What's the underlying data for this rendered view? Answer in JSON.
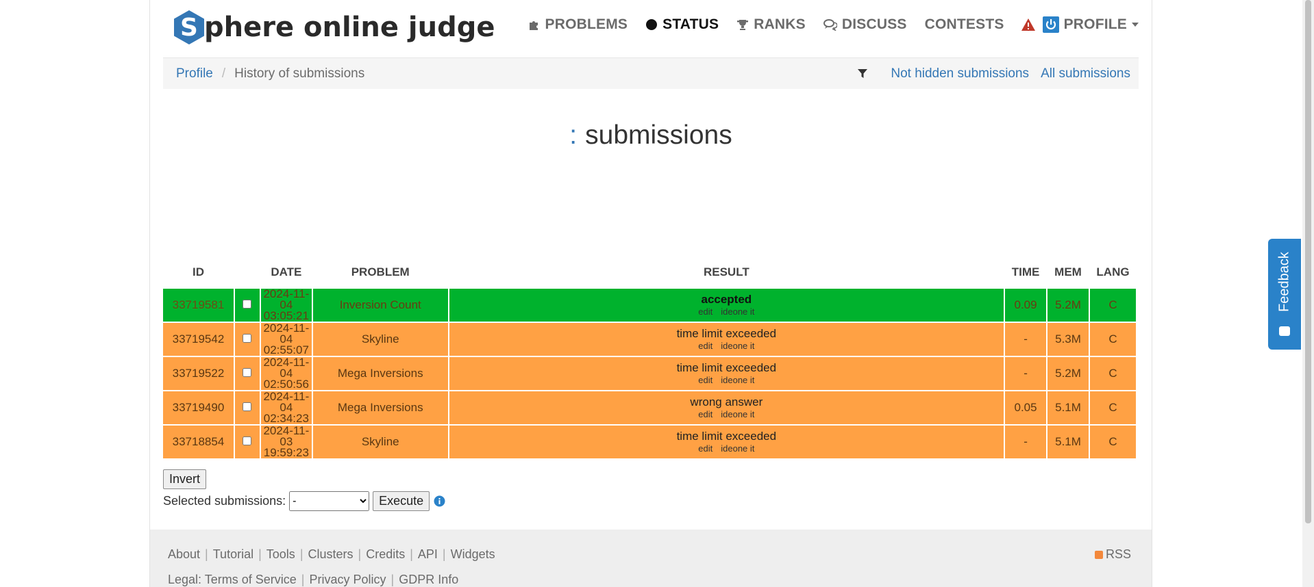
{
  "header": {
    "logo_letter": "S",
    "logo_text": "phere online judge",
    "nav": {
      "problems": "PROBLEMS",
      "status": "STATUS",
      "ranks": "RANKS",
      "discuss": "DISCUSS",
      "contests": "CONTESTS",
      "profile": "PROFILE"
    }
  },
  "breadcrumb": {
    "profile": "Profile",
    "current": "History of submissions"
  },
  "filters": {
    "not_hidden": "Not hidden submissions",
    "all": "All submissions"
  },
  "page": {
    "title_prefix": ":",
    "title": "submissions"
  },
  "table": {
    "headers": {
      "id": "ID",
      "date": "DATE",
      "problem": "PROBLEM",
      "result": "RESULT",
      "time": "TIME",
      "mem": "MEM",
      "lang": "LANG"
    },
    "links": {
      "edit": "edit",
      "ideone": "ideone it"
    },
    "rows": [
      {
        "id": "33719581",
        "date": "2024-11-04",
        "time_of_day": "03:05:21",
        "problem": "Inversion Count",
        "result": "accepted",
        "time": "0.09",
        "mem": "5.2M",
        "lang": "C",
        "status_color": "#00b22d"
      },
      {
        "id": "33719542",
        "date": "2024-11-04",
        "time_of_day": "02:55:07",
        "problem": "Skyline",
        "result": "time limit exceeded",
        "time": "-",
        "mem": "5.3M",
        "lang": "C",
        "status_color": "#ffa144"
      },
      {
        "id": "33719522",
        "date": "2024-11-04",
        "time_of_day": "02:50:56",
        "problem": "Mega Inversions",
        "result": "time limit exceeded",
        "time": "-",
        "mem": "5.2M",
        "lang": "C",
        "status_color": "#ffa144"
      },
      {
        "id": "33719490",
        "date": "2024-11-04",
        "time_of_day": "02:34:23",
        "problem": "Mega Inversions",
        "result": "wrong answer",
        "time": "0.05",
        "mem": "5.1M",
        "lang": "C",
        "status_color": "#ffa144"
      },
      {
        "id": "33718854",
        "date": "2024-11-03",
        "time_of_day": "19:59:23",
        "problem": "Skyline",
        "result": "time limit exceeded",
        "time": "-",
        "mem": "5.1M",
        "lang": "C",
        "status_color": "#ffa144"
      }
    ]
  },
  "controls": {
    "invert_label": "Invert",
    "selected_label": "Selected submissions:",
    "select_value": "-",
    "execute_label": "Execute"
  },
  "footer": {
    "links": [
      "About",
      "Tutorial",
      "Tools",
      "Clusters",
      "Credits",
      "API",
      "Widgets"
    ],
    "legal_label": "Legal:",
    "legal_links": [
      "Terms of Service",
      "Privacy Policy",
      "GDPR Info"
    ],
    "rss": "RSS"
  },
  "feedback": {
    "label": "Feedback"
  },
  "colors": {
    "accent": "#3477b5",
    "accepted": "#00b22d",
    "rejected": "#ffa144",
    "feedback": "#2a82c9"
  }
}
